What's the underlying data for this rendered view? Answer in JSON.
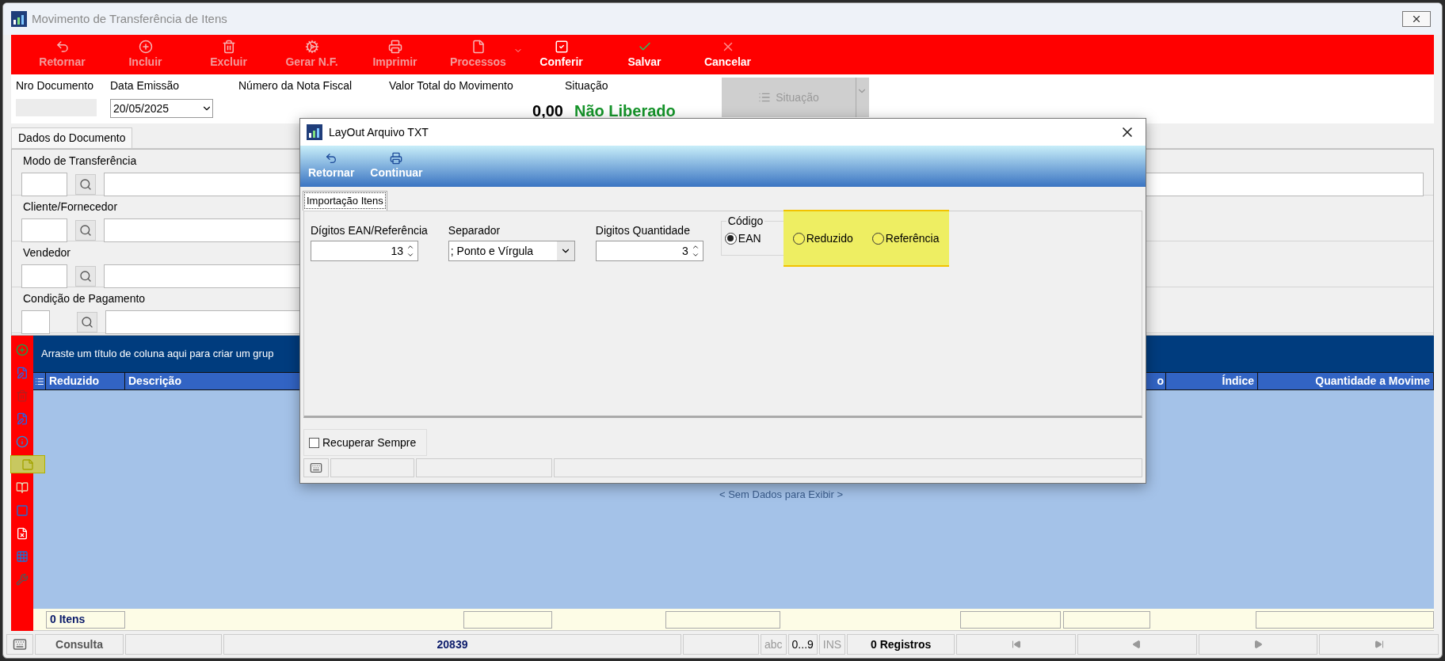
{
  "window": {
    "title": "Movimento de Transferência de Itens"
  },
  "toolbar": [
    {
      "label": "Retornar",
      "disabled": true,
      "has_menu": false
    },
    {
      "label": "Incluir",
      "disabled": true,
      "has_menu": false
    },
    {
      "label": "Excluir",
      "disabled": true,
      "has_menu": false
    },
    {
      "label": "Gerar N.F.",
      "disabled": true,
      "has_menu": false
    },
    {
      "label": "Imprimir",
      "disabled": true,
      "has_menu": false
    },
    {
      "label": "Processos",
      "disabled": true,
      "has_menu": true
    },
    {
      "label": "Conferir",
      "disabled": false,
      "has_menu": false
    },
    {
      "label": "Salvar",
      "disabled": false,
      "has_menu": false
    },
    {
      "label": "Cancelar",
      "disabled": false,
      "has_menu": false
    }
  ],
  "header": {
    "labels": [
      "Nro Documento",
      "Data Emissão",
      "Número da Nota Fiscal",
      "Valor Total do Movimento",
      "Situação"
    ],
    "date": "20/05/2025",
    "total": "0,00",
    "status": "Não Liberado",
    "status_button": {
      "label": "Situação",
      "disabled": true
    }
  },
  "tabs": [
    {
      "label": "Dados do Documento",
      "selected": true
    }
  ],
  "form_fields": [
    "Modo de Transferência",
    "Cliente/Fornecedor",
    "Vendedor",
    "Condição de Pagamento"
  ],
  "side_tools": [
    {
      "highlighted": false
    },
    {
      "highlighted": false
    },
    {
      "highlighted": false
    },
    {
      "highlighted": false
    },
    {
      "highlighted": false
    },
    {
      "highlighted": true
    },
    {
      "highlighted": false
    },
    {
      "highlighted": false
    },
    {
      "highlighted": false
    },
    {
      "highlighted": false
    },
    {
      "highlighted": false
    }
  ],
  "grid": {
    "group_hint": "Arraste um título de coluna aqui para criar um grup",
    "columns": [
      "Reduzido",
      "Descrição",
      "o",
      "Índice",
      "Quantidade a Movime"
    ],
    "empty_text": "< Sem Dados para Exibir >",
    "footer_count": "0 Itens"
  },
  "status_bar": {
    "mode": "Consulta",
    "code": "20839",
    "indicators": [
      "abc",
      "0...9",
      "INS"
    ],
    "records": "0 Registros"
  },
  "dialog": {
    "title": "LayOut Arquivo TXT",
    "toolbar": [
      "Retornar",
      "Continuar"
    ],
    "tabs": [
      {
        "label": "Importação Itens",
        "selected": true
      }
    ],
    "fields": [
      {
        "label": "Dígitos EAN/Referência",
        "kind": "spin",
        "value": "13"
      },
      {
        "label": "Separador",
        "kind": "select",
        "value": "; Ponto e Vírgula"
      },
      {
        "label": "Digitos Quantidade",
        "kind": "spin",
        "value": "3"
      }
    ],
    "code_group": {
      "label": "Código",
      "options": [
        {
          "label": "EAN",
          "selected": true,
          "highlighted": false
        },
        {
          "label": "Reduzido",
          "selected": false,
          "highlighted": true
        },
        {
          "label": "Referência",
          "selected": false,
          "highlighted": true
        }
      ]
    },
    "recover": {
      "label": "Recuperar Sempre",
      "checked": false
    }
  }
}
